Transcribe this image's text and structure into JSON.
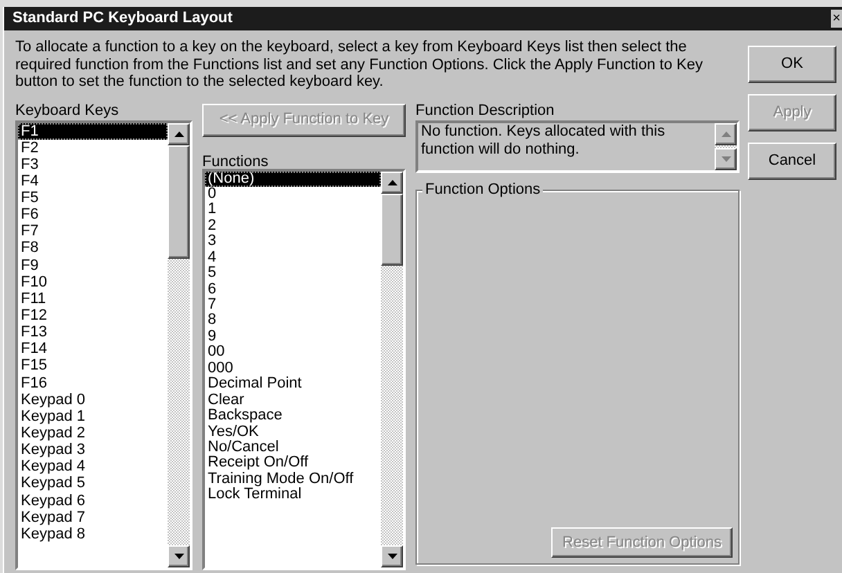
{
  "window": {
    "title": "Standard PC Keyboard Layout",
    "close": "×"
  },
  "instructions": "To allocate a function to a key on the keyboard, select a key from Keyboard Keys list then select the required function from the Functions list and set any Function Options.  Click the Apply Function to Key button to set the function to the selected keyboard key.",
  "keyboard_keys": {
    "label": "Keyboard Keys",
    "items": [
      {
        "label": "F1",
        "selected": true
      },
      {
        "label": "F2",
        "selected": false
      },
      {
        "label": "F3",
        "selected": false
      },
      {
        "label": "F4",
        "selected": false
      },
      {
        "label": "F5",
        "selected": false
      },
      {
        "label": "F6",
        "selected": false
      },
      {
        "label": "F7",
        "selected": false
      },
      {
        "label": "F8",
        "selected": false
      },
      {
        "label": "F9",
        "selected": false
      },
      {
        "label": "F10",
        "selected": false
      },
      {
        "label": "F11",
        "selected": false
      },
      {
        "label": "F12",
        "selected": false
      },
      {
        "label": "F13",
        "selected": false
      },
      {
        "label": "F14",
        "selected": false
      },
      {
        "label": "F15",
        "selected": false
      },
      {
        "label": "F16",
        "selected": false
      },
      {
        "label": "Keypad 0",
        "selected": false
      },
      {
        "label": "Keypad 1",
        "selected": false
      },
      {
        "label": "Keypad 2",
        "selected": false
      },
      {
        "label": "Keypad 3",
        "selected": false
      },
      {
        "label": "Keypad 4",
        "selected": false
      },
      {
        "label": "Keypad 5",
        "selected": false
      },
      {
        "label": "Keypad 6",
        "selected": false
      },
      {
        "label": "Keypad 7",
        "selected": false
      },
      {
        "label": "Keypad 8",
        "selected": false
      }
    ]
  },
  "apply_function_button": {
    "label": "<< Apply Function to Key",
    "disabled": true
  },
  "functions": {
    "label": "Functions",
    "items": [
      {
        "label": "(None)",
        "selected": true
      },
      {
        "label": "0",
        "selected": false
      },
      {
        "label": "1",
        "selected": false
      },
      {
        "label": "2",
        "selected": false
      },
      {
        "label": "3",
        "selected": false
      },
      {
        "label": "4",
        "selected": false
      },
      {
        "label": "5",
        "selected": false
      },
      {
        "label": "6",
        "selected": false
      },
      {
        "label": "7",
        "selected": false
      },
      {
        "label": "8",
        "selected": false
      },
      {
        "label": "9",
        "selected": false
      },
      {
        "label": "00",
        "selected": false
      },
      {
        "label": "000",
        "selected": false
      },
      {
        "label": "Decimal Point",
        "selected": false
      },
      {
        "label": "Clear",
        "selected": false
      },
      {
        "label": "Backspace",
        "selected": false
      },
      {
        "label": "Yes/OK",
        "selected": false
      },
      {
        "label": "No/Cancel",
        "selected": false
      },
      {
        "label": "Receipt On/Off",
        "selected": false
      },
      {
        "label": "Training Mode On/Off",
        "selected": false
      },
      {
        "label": "Lock Terminal",
        "selected": false
      }
    ]
  },
  "function_description": {
    "label": "Function Description",
    "text": "No function.  Keys allocated with this function will do nothing."
  },
  "function_options": {
    "label": "Function Options",
    "reset_button": {
      "label": "Reset Function Options",
      "disabled": true
    }
  },
  "buttons": [
    {
      "label": "OK",
      "disabled": false
    },
    {
      "label": "Apply",
      "disabled": true
    },
    {
      "label": "Cancel",
      "disabled": false
    }
  ]
}
